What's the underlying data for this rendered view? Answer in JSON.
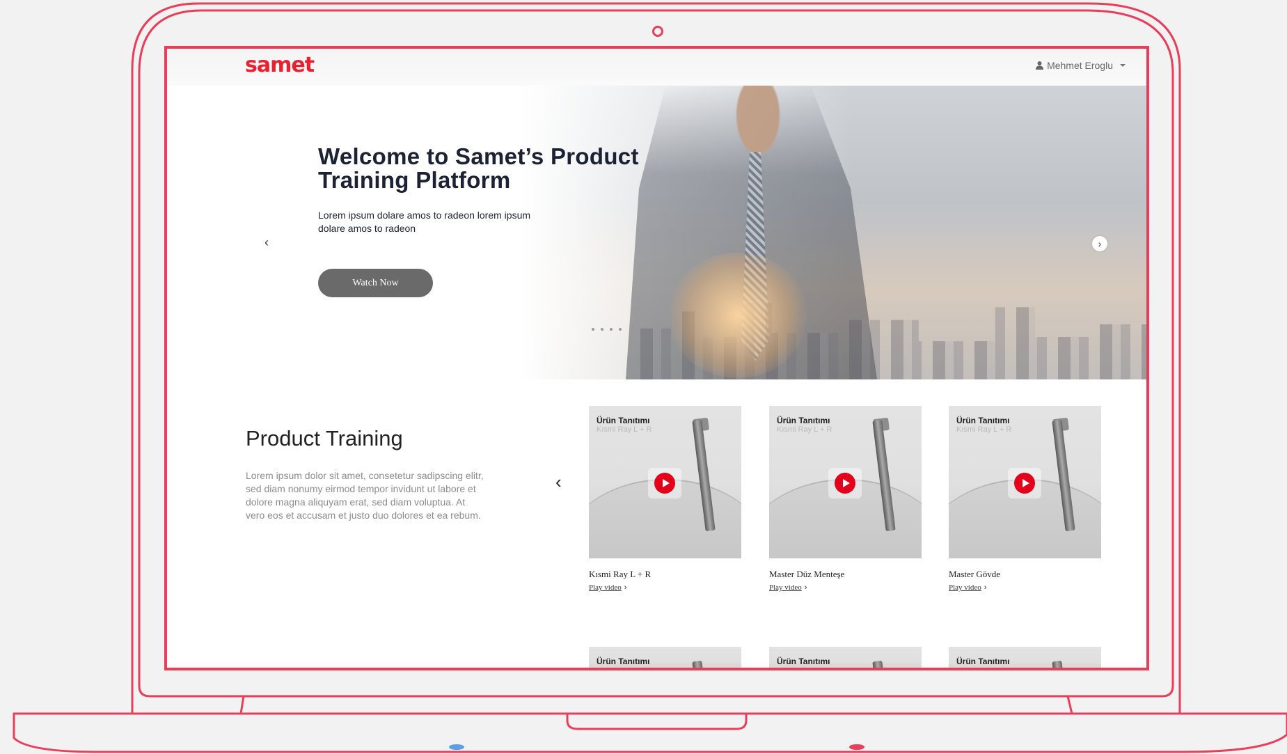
{
  "brand": {
    "logo_text": "samet",
    "accent": "#e8202f",
    "frame_color": "#e83e5a"
  },
  "nav": {
    "user_name": "Mehmet Eroglu",
    "user_icon": "user-icon"
  },
  "hero": {
    "title": "Welcome to Samet’s Product Training Platform",
    "subtitle": "Lorem ipsum dolare amos to radeon lorem ipsum dolare amos to radeon",
    "cta_label": "Watch Now",
    "prev_icon": "‹",
    "next_icon": "›",
    "slide_count": 4
  },
  "training": {
    "heading": "Product Training",
    "description": "Lorem ipsum dolor sit amet, consetetur sadipscing elitr, sed diam nonumy eirmod tempor invidunt ut labore et dolore magna aliquyam erat, sed diam voluptua. At vero eos et accusam et justo duo dolores et ea rebum.",
    "prev_icon": "‹",
    "next_icon": "›",
    "cards": [
      {
        "badge": "Ürün Tanıtımı",
        "badge_sub": "Kısmi Ray L + R",
        "title": "Kısmi Ray L + R",
        "link": "Play video"
      },
      {
        "badge": "Ürün Tanıtımı",
        "badge_sub": "Kısmi Ray L + R",
        "title": "Master Düz Menteşe",
        "link": "Play video"
      },
      {
        "badge": "Ürün Tanıtımı",
        "badge_sub": "Kısmi Ray L + R",
        "title": "Master Gövde",
        "link": "Play video"
      }
    ],
    "row2": [
      {
        "badge": "Ürün Tanıtımı"
      },
      {
        "badge": "Ürün Tanıtımı"
      },
      {
        "badge": "Ürün Tanıtımı"
      }
    ]
  }
}
